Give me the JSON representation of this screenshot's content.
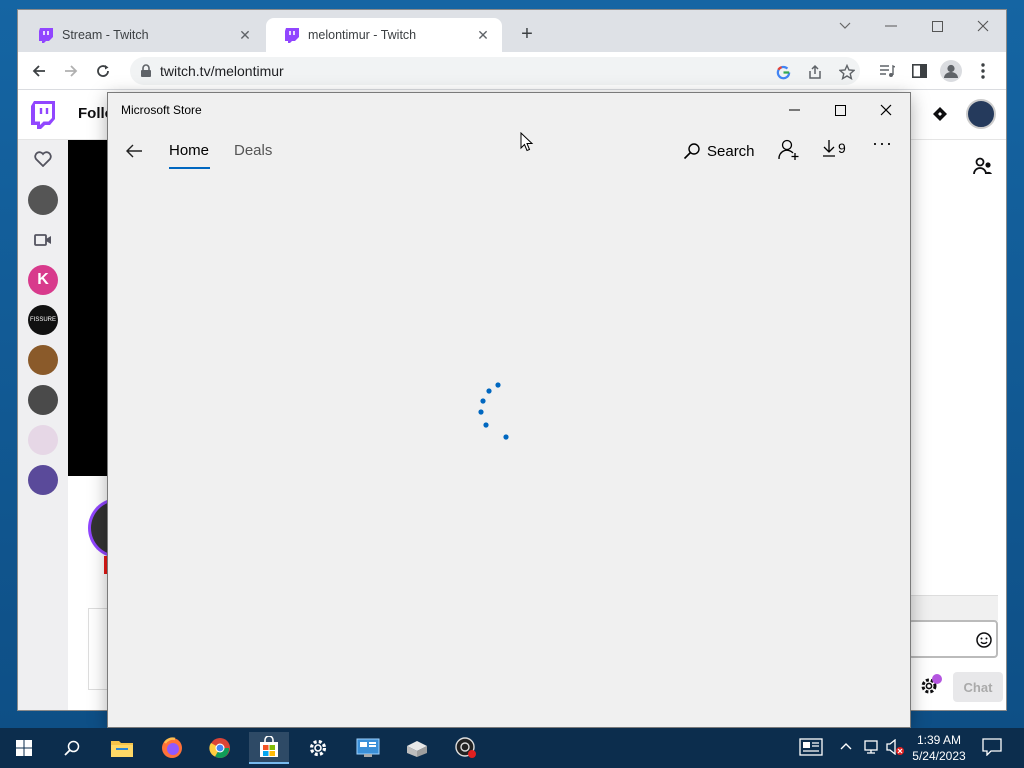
{
  "browser": {
    "tabs": [
      {
        "title": "Stream - Twitch"
      },
      {
        "title": "melontimur - Twitch"
      }
    ],
    "url": "twitch.tv/melontimur"
  },
  "twitch": {
    "following_label": "Follo",
    "chat_button": "Chat"
  },
  "store": {
    "window_title": "Microsoft Store",
    "nav": {
      "home": "Home",
      "deals": "Deals",
      "search": "Search",
      "downloads_count": "9"
    },
    "loading": true
  },
  "taskbar": {
    "time": "1:39 AM",
    "date": "5/24/2023"
  },
  "colors": {
    "twitch_purple": "#9146ff",
    "store_accent": "#0067c0",
    "taskbar": "#0c2d4d"
  }
}
